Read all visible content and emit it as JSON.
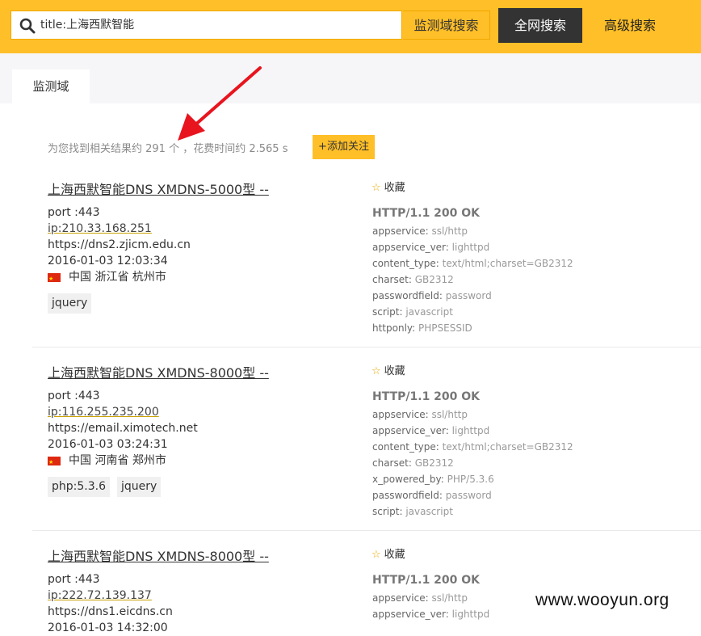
{
  "header": {
    "search_query": "title:上海西默智能",
    "monitor_search_label": "监测域搜索",
    "all_search_label": "全网搜索",
    "advanced_search_label": "高级搜索"
  },
  "tabs": [
    {
      "label": "监测域"
    }
  ],
  "summary": {
    "text": "为您找到相关结果约 291 个 ，花费时间约 2.565 s",
    "follow_label": "+添加关注"
  },
  "favorite_label": "收藏",
  "results": [
    {
      "title": "上海西默智能DNS XMDNS-5000型 --",
      "port": "port :443",
      "ip": "ip:210.33.168.251",
      "url": "https://dns2.zjicm.edu.cn",
      "time": "2016-01-03 12:03:34",
      "location": "中国 浙江省 杭州市",
      "tags": [
        "jquery"
      ],
      "status": "HTTP/1.1 200 OK",
      "headers": [
        {
          "key": "appservice:",
          "value": "ssl/http"
        },
        {
          "key": "appservice_ver:",
          "value": "lighttpd"
        },
        {
          "key": "content_type:",
          "value": "text/html;charset=GB2312"
        },
        {
          "key": "charset:",
          "value": "GB2312"
        },
        {
          "key": "passwordfield:",
          "value": "password"
        },
        {
          "key": "script:",
          "value": "javascript"
        },
        {
          "key": "httponly:",
          "value": "PHPSESSID"
        }
      ]
    },
    {
      "title": "上海西默智能DNS XMDNS-8000型 --",
      "port": "port :443",
      "ip": "ip:116.255.235.200",
      "url": "https://email.ximotech.net",
      "time": "2016-01-03 03:24:31",
      "location": "中国 河南省 郑州市",
      "tags": [
        "php:5.3.6",
        "jquery"
      ],
      "status": "HTTP/1.1 200 OK",
      "headers": [
        {
          "key": "appservice:",
          "value": "ssl/http"
        },
        {
          "key": "appservice_ver:",
          "value": "lighttpd"
        },
        {
          "key": "content_type:",
          "value": "text/html;charset=GB2312"
        },
        {
          "key": "charset:",
          "value": "GB2312"
        },
        {
          "key": "x_powered_by:",
          "value": "PHP/5.3.6"
        },
        {
          "key": "passwordfield:",
          "value": "password"
        },
        {
          "key": "script:",
          "value": "javascript"
        }
      ]
    },
    {
      "title": "上海西默智能DNS XMDNS-8000型 --",
      "port": "port :443",
      "ip": "ip:222.72.139.137",
      "url": "https://dns1.eicdns.cn",
      "time": "2016-01-03 14:32:00",
      "location": "",
      "tags": [],
      "status": "HTTP/1.1 200 OK",
      "headers": [
        {
          "key": "appservice:",
          "value": "ssl/http"
        },
        {
          "key": "appservice_ver:",
          "value": "lighttpd"
        }
      ]
    }
  ],
  "watermark": "www.wooyun.org",
  "colors": {
    "accent": "#ffbf28",
    "dark_button": "#333333",
    "arrow": "#e8141e"
  }
}
